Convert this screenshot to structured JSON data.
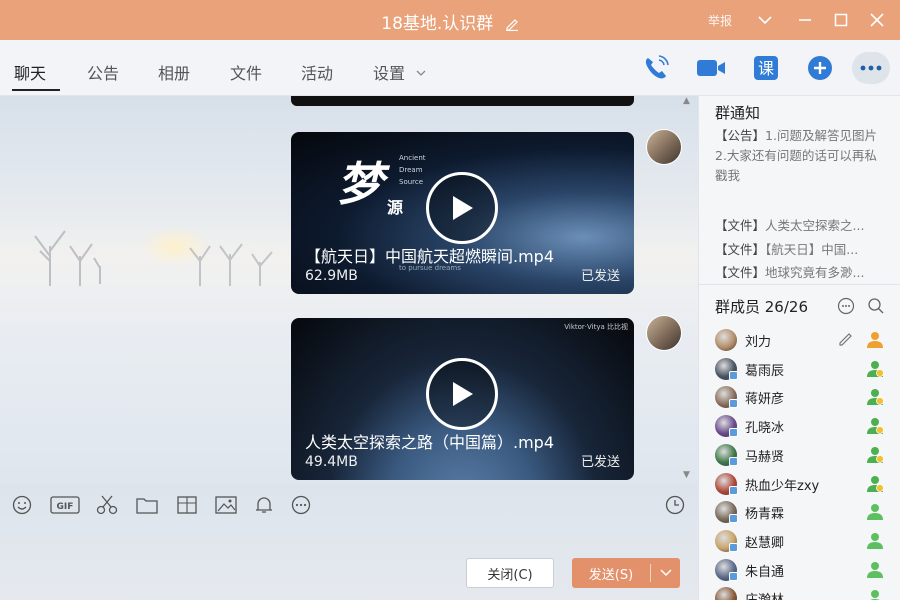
{
  "window": {
    "title": "18基地.认识群",
    "report_label": "举报"
  },
  "tabs": [
    {
      "label": "聊天"
    },
    {
      "label": "公告"
    },
    {
      "label": "相册"
    },
    {
      "label": "文件"
    },
    {
      "label": "活动"
    },
    {
      "label": "设置"
    }
  ],
  "messages": [
    {
      "file_name": "【航天日】中国航天超燃瞬间.mp4",
      "size": "62.9MB",
      "status": "已发送",
      "overlay_big": "梦",
      "overlay_small": "源",
      "overlay_en": [
        "Ancient",
        "Dream",
        "Source",
        "to pursue dreams"
      ]
    },
    {
      "file_name": "人类太空探索之路（中国篇）.mp4",
      "size": "49.4MB",
      "status": "已发送",
      "watermark": "Viktor·Vitya 比比视"
    }
  ],
  "input": {
    "close_label": "关闭(C)",
    "send_label": "发送(S)"
  },
  "notice": {
    "title": "群通知",
    "announcement_tag": "【公告】",
    "announcement_text": "1.问题及解答见图片",
    "announcement_text2": "2.大家还有问题的话可以再私戳我",
    "files": [
      {
        "tag": "【文件】",
        "name": "人类太空探索之..."
      },
      {
        "tag": "【文件】",
        "name": "【航天日】中国..."
      },
      {
        "tag": "【文件】",
        "name": "地球究竟有多渺..."
      }
    ]
  },
  "members": {
    "title": "群成员 26/26",
    "list": [
      {
        "name": "刘力",
        "av": "#b48e6a",
        "role": "owner"
      },
      {
        "name": "葛雨辰",
        "av": "#4a5563",
        "role": "admin"
      },
      {
        "name": "蒋妍彦",
        "av": "#8a6f5c",
        "role": "admin"
      },
      {
        "name": "孔晓冰",
        "av": "#6a4c8c",
        "role": "admin"
      },
      {
        "name": "马赫贤",
        "av": "#3e7a4a",
        "role": "admin"
      },
      {
        "name": "热血少年zxy",
        "av": "#b04a3a",
        "role": "admin"
      },
      {
        "name": "杨青霖",
        "av": "#7a6a5a",
        "role": "member"
      },
      {
        "name": "赵慧卿",
        "av": "#c9a46a",
        "role": "member"
      },
      {
        "name": "朱自通",
        "av": "#5a6a8a",
        "role": "member"
      },
      {
        "name": "庄瀚林",
        "av": "#8a5a3a",
        "role": "member"
      }
    ]
  },
  "colors": {
    "title_bar": "#e9a27a",
    "send_button": "#e3916a",
    "accent_blue": "#2f7bd6"
  }
}
